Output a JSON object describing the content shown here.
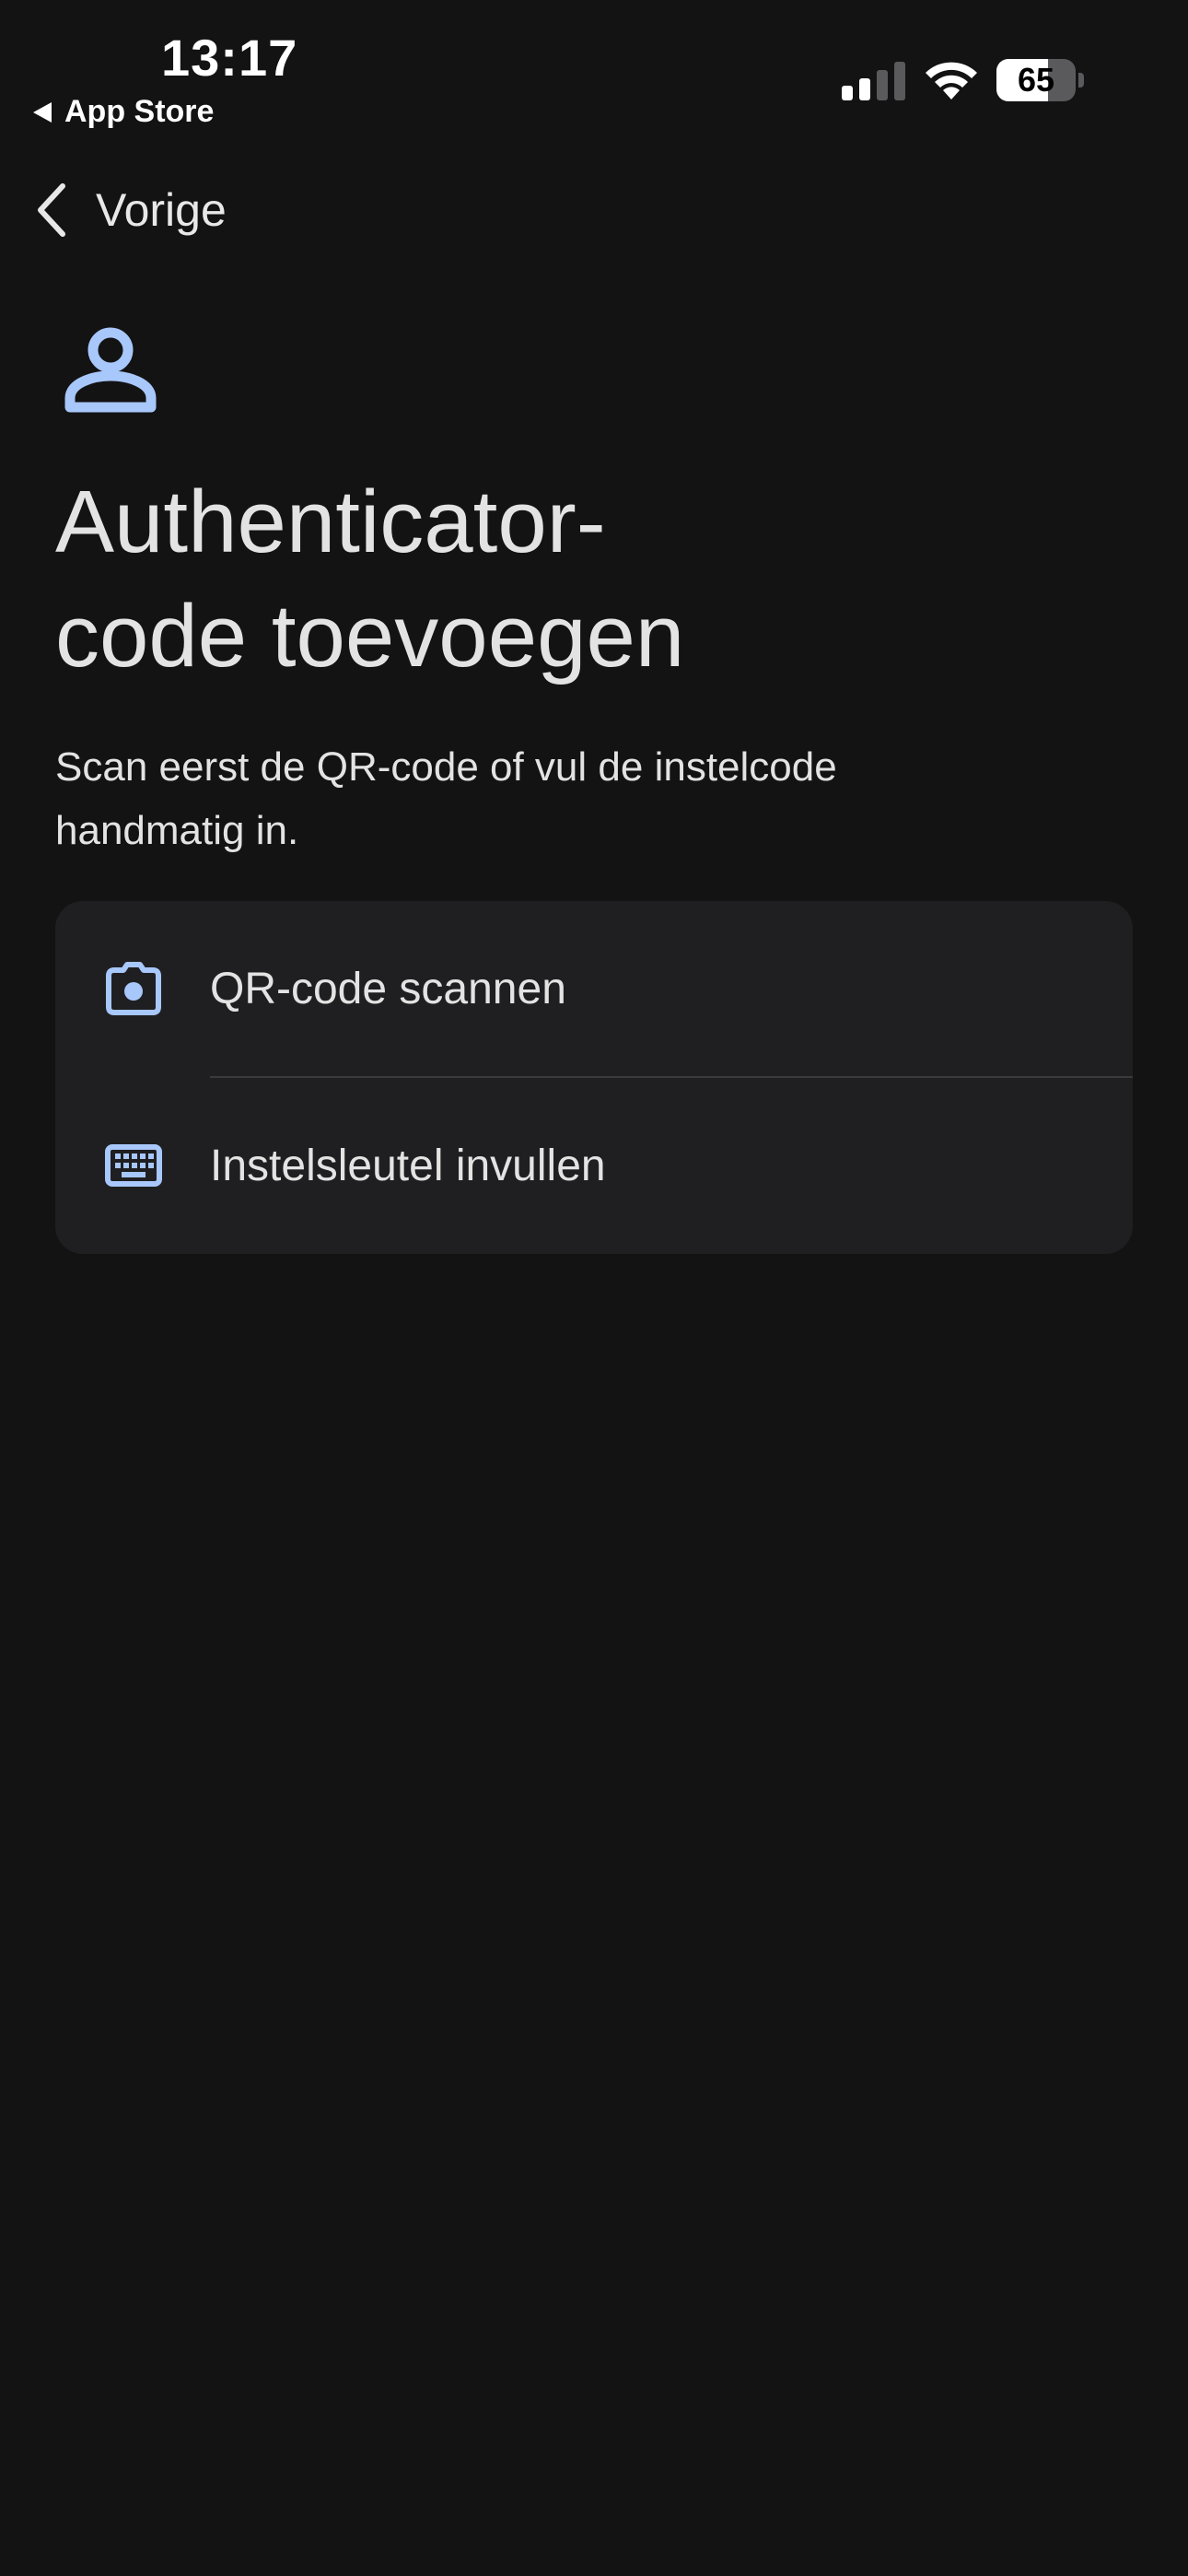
{
  "status_bar": {
    "time": "13:17",
    "back_app": "App Store",
    "battery_percent": 65,
    "battery_label": "65",
    "signal_bars_active": 2,
    "signal_bars_total": 4
  },
  "nav": {
    "back_label": "Vorige"
  },
  "header": {
    "icon": "account-icon",
    "title_line1": "Authenticator-",
    "title_line2": "code toevoegen",
    "subtitle_line1": "Scan eerst de QR-code of vul de instelcode",
    "subtitle_line2": "handmatig in."
  },
  "options": [
    {
      "label": "QR-code scannen",
      "icon": "camera-icon"
    },
    {
      "label": "Instelsleutel invullen",
      "icon": "keyboard-icon"
    }
  ],
  "colors": {
    "background": "#131314",
    "card": "#1f1f21",
    "accent": "#a8c7fa",
    "text": "#e3e3e3"
  }
}
